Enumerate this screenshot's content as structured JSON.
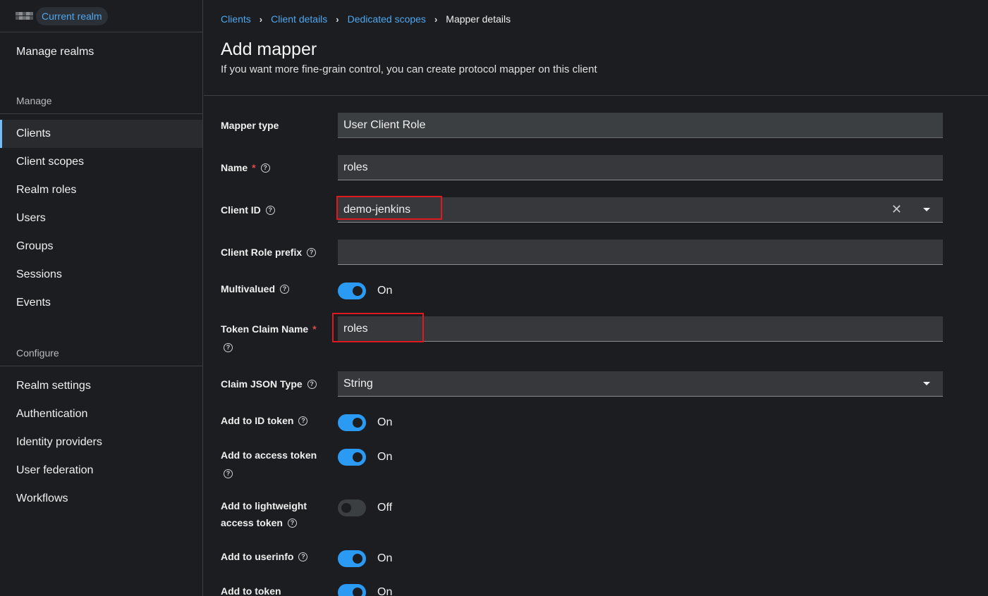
{
  "sidebar": {
    "realm_badge": "Current realm",
    "manage_realms": "Manage realms",
    "manage_title": "Manage",
    "manage_items": [
      "Clients",
      "Client scopes",
      "Realm roles",
      "Users",
      "Groups",
      "Sessions",
      "Events"
    ],
    "configure_title": "Configure",
    "configure_items": [
      "Realm settings",
      "Authentication",
      "Identity providers",
      "User federation",
      "Workflows"
    ]
  },
  "breadcrumb": {
    "clients": "Clients",
    "client_details": "Client details",
    "dedicated_scopes": "Dedicated scopes",
    "current": "Mapper details"
  },
  "page": {
    "title": "Add mapper",
    "description": "If you want more fine-grain control, you can create protocol mapper on this client"
  },
  "form": {
    "mapper_type": {
      "label": "Mapper type",
      "value": "User Client Role"
    },
    "name": {
      "label": "Name",
      "value": "roles",
      "required": "*"
    },
    "client_id": {
      "label": "Client ID",
      "value": "demo-jenkins",
      "clear": "✕"
    },
    "client_role_prefix": {
      "label": "Client Role prefix",
      "value": ""
    },
    "multivalued": {
      "label": "Multivalued",
      "state": "On"
    },
    "token_claim_name": {
      "label": "Token Claim Name",
      "value": "roles",
      "required": "*"
    },
    "claim_json_type": {
      "label": "Claim JSON Type",
      "value": "String"
    },
    "add_to_id_token": {
      "label": "Add to ID token",
      "state": "On"
    },
    "add_to_access_token": {
      "label": "Add to access token",
      "state": "On"
    },
    "add_to_lightweight": {
      "label_line1": "Add to lightweight",
      "label_line2": "access token",
      "state": "Off"
    },
    "add_to_userinfo": {
      "label": "Add to userinfo",
      "state": "On"
    },
    "add_to_token": {
      "label": "Add to token",
      "state": "On"
    }
  },
  "help_glyph": "?",
  "colors": {
    "accent": "#2b9af3",
    "link": "#4fa7ef",
    "highlight": "#e0191e"
  }
}
